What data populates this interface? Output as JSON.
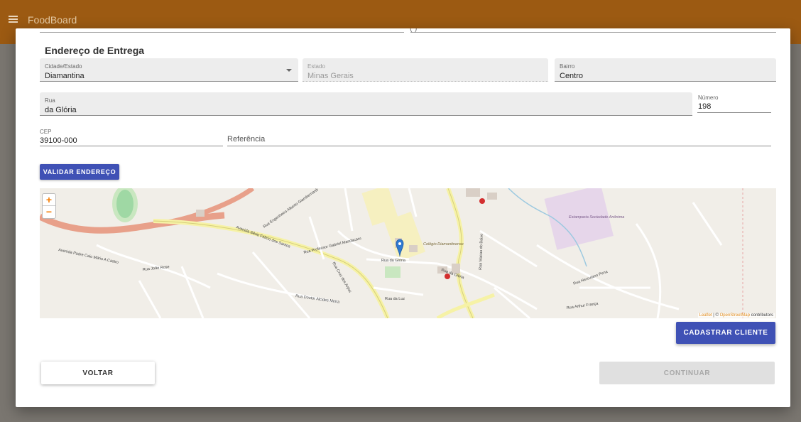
{
  "appbar": {
    "title": "FoodBoard"
  },
  "dialog": {
    "section_title": "Endereço de Entrega",
    "top_fragment": "( )",
    "fields": {
      "cidade": {
        "label": "Cidade/Estado",
        "value": "Diamantina"
      },
      "estado": {
        "label": "Estado",
        "value": "Minas Gerais"
      },
      "bairro": {
        "label": "Bairro",
        "value": "Centro"
      },
      "rua": {
        "label": "Rua",
        "value": "da Glória"
      },
      "numero": {
        "label": "Número",
        "value": "198"
      },
      "cep": {
        "label": "CEP",
        "value": "39100-000"
      },
      "referencia": {
        "placeholder": "Referência"
      }
    },
    "buttons": {
      "validate": "VALIDAR ENDEREÇO",
      "register": "CADASTRAR CLIENTE",
      "back": "VOLTAR",
      "continue": "CONTINUAR"
    }
  },
  "map": {
    "zoom_in": "+",
    "zoom_out": "−",
    "attribution": {
      "leaflet": "Leaflet",
      "sep": " | © ",
      "osm": "OpenStreetMap",
      "suffix": " contributors"
    },
    "labels": {
      "avenida": "Avenida Silvio Felicio dos Santos",
      "gloria": "Rua da Glória",
      "gloria2": "Rua da Glória",
      "luz": "Rua da Luz",
      "macau": "Rua Macau do Baixo",
      "colegio": "Colégio Diamantinense",
      "estamparia": "Estamparia Sociedade Anônima",
      "caio": "Avenida Padre Caio Mário A Castro",
      "joao": "Rua João Rose",
      "gabriel": "Rua Professor Gabriel Mandacaru",
      "alcides": "Rua Doutor Alcides Meira",
      "arthur": "Rua Arthur França",
      "herculano": "Rua Herculano Pena",
      "cruz": "Rua Cruz dos Anjos",
      "engenheiro": "Rua Engenheiro Alberto Giambernardi",
      "carmo": "Rua Arthur França"
    },
    "colors": {
      "road_major": "#e8a08a",
      "road_yellow": "#f6f2a6",
      "marker": "#2f7ad1",
      "park": "#c9e7c0",
      "industrial": "#e6d6ea"
    }
  }
}
